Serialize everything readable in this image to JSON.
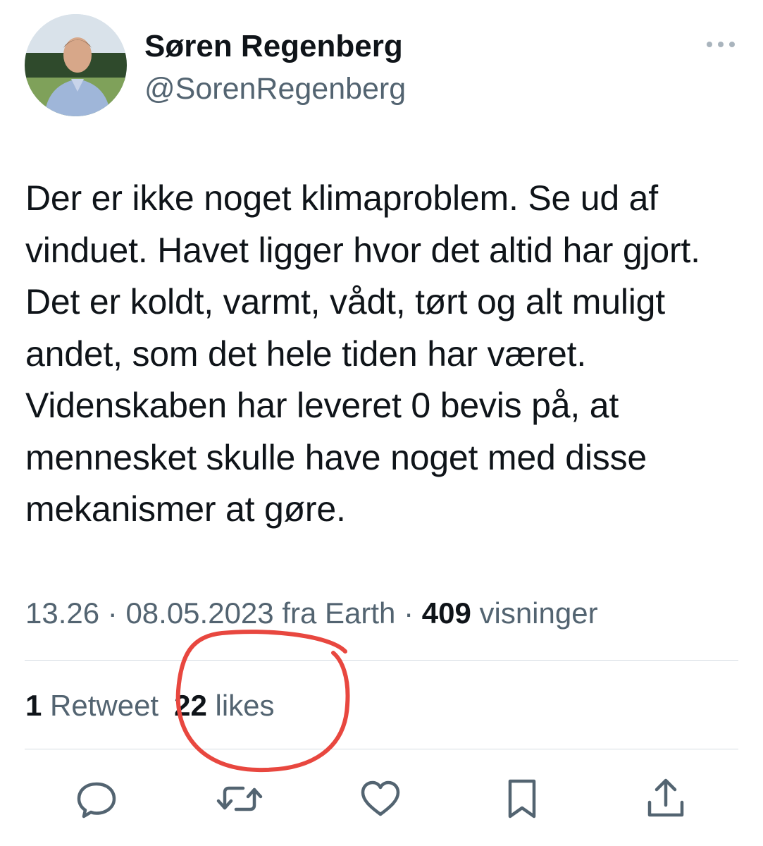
{
  "author": {
    "display_name": "Søren Regenberg",
    "handle": "@SorenRegenberg",
    "avatar_icon": "profile-photo"
  },
  "tweet": {
    "text": "Der er ikke noget klimaproblem. Se ud af vinduet. Havet ligger hvor det altid har gjort. Det er koldt, varmt, vådt, tørt og alt muligt andet, som det hele tiden har været. Videnskaben har leveret 0 bevis på, at mennesket skulle have noget med disse mekanismer at gøre."
  },
  "meta": {
    "time": "13.26",
    "separator": " · ",
    "date": "08.05.2023",
    "source": " fra Earth",
    "views_count": "409",
    "views_label": " visninger"
  },
  "stats": {
    "retweets_count": "1",
    "retweets_label": " Retweet",
    "likes_count": "22",
    "likes_label": " likes"
  },
  "actions": {
    "reply_icon": "reply-icon",
    "retweet_icon": "retweet-icon",
    "like_icon": "heart-icon",
    "bookmark_icon": "bookmark-icon",
    "share_icon": "share-icon"
  },
  "colors": {
    "text_primary": "#0f1419",
    "text_secondary": "#536471",
    "annotation_red": "#e8473f",
    "divider": "#d6dde3"
  }
}
